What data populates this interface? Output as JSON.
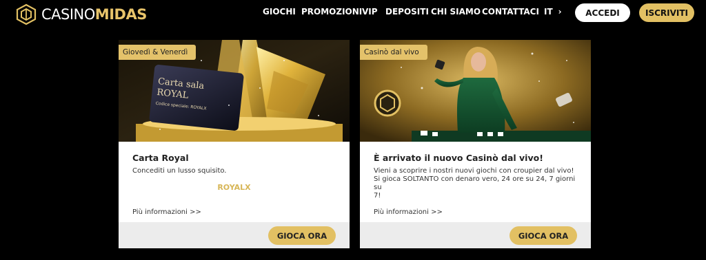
{
  "brand": {
    "part1": "CASINO",
    "part2": "MIDAS"
  },
  "nav": [
    "GIOCHI",
    "PROMOZIONI",
    "VIP",
    "DEPOSITI",
    "CHI SIAMO",
    "CONTATTACI"
  ],
  "language": {
    "code": "IT",
    "arrow": "›"
  },
  "header_buttons": {
    "login": "ACCEDI",
    "signup": "ISCRIVITI"
  },
  "colors": {
    "gold": "#e2c063",
    "background": "#000000",
    "card": "#ffffff",
    "footer": "#ececec"
  },
  "cards": [
    {
      "tag": "Giovedì & Venerdì",
      "image_card_title": "Carta sala",
      "image_card_subtitle": "ROYAL",
      "image_card_code": "Codice speciale: ROYALX",
      "title": "Carta Royal",
      "text": "Concediti un lusso squisito.",
      "code": "ROYALX",
      "more": "Più informazioni >>",
      "button": "GIOCA ORA"
    },
    {
      "tag": "Casinò dal vivo",
      "title": "È arrivato il nuovo Casinò dal vivo!",
      "text_line1": "Vieni a scoprire i nostri nuovi giochi con croupier dal vivo!",
      "text_line2": "Si gioca SOLTANTO con denaro vero, 24 ore su 24, 7 giorni su",
      "text_line3": "7!",
      "more": "Più informazioni >>",
      "button": "GIOCA ORA"
    }
  ]
}
